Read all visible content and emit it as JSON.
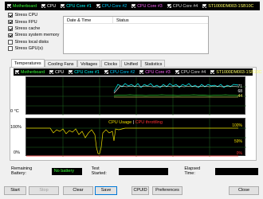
{
  "colors": {
    "motherboard": "#39ff39",
    "cpu": "#ffffff",
    "core1": "#00ffff",
    "core2": "#00ccff",
    "core3": "#ff66ff",
    "core4": "#dddddd",
    "disk": "#ffff66",
    "usage": "#f0e000",
    "throttling": "#ff3030"
  },
  "top_legend": [
    {
      "label": "Motherboard",
      "checked": true,
      "color": "#39ff39"
    },
    {
      "label": "CPU",
      "checked": true,
      "color": "#ffffff"
    },
    {
      "label": "CPU Core #1",
      "checked": true,
      "color": "#00ffff"
    },
    {
      "label": "CPU Core #2",
      "checked": true,
      "color": "#00ccff"
    },
    {
      "label": "CPU Core #3",
      "checked": true,
      "color": "#ff66ff"
    },
    {
      "label": "CPU Core #4",
      "checked": true,
      "color": "#dddddd"
    },
    {
      "label": "ST1000DM003-1SB10C",
      "checked": true,
      "color": "#ffff66"
    }
  ],
  "stress_options": [
    {
      "label": "Stress CPU",
      "checked": true
    },
    {
      "label": "Stress FPU",
      "checked": true
    },
    {
      "label": "Stress cache",
      "checked": true
    },
    {
      "label": "Stress system memory",
      "checked": true
    },
    {
      "label": "Stress local disks",
      "checked": false
    },
    {
      "label": "Stress GPU(s)",
      "checked": false
    }
  ],
  "log_table": {
    "col_date": "Date & Time",
    "col_status": "Status"
  },
  "tabs": [
    "Temperatures",
    "Cooling Fans",
    "Voltages",
    "Clocks",
    "Unified",
    "Statistics"
  ],
  "active_tab": "Temperatures",
  "temp_graph": {
    "y_top": "100 °C",
    "y_bottom": "0 °C",
    "right_values": [
      "71",
      "68",
      "44"
    ]
  },
  "usage_graph": {
    "title_usage": "CPU Usage",
    "title_sep": "|",
    "title_throttling": "CPU throttling",
    "y_top": "100%",
    "y_bottom": "0%",
    "right_top": "100%",
    "right_mid": "59%",
    "right_bottom": "0%"
  },
  "status_row": {
    "remaining_battery_label": "Remaining Battery:",
    "remaining_battery_value": "No battery",
    "test_started_label": "Test Started:",
    "test_started_value": "",
    "elapsed_time_label": "Elapsed Time:",
    "elapsed_time_value": ""
  },
  "buttons": {
    "start": "Start",
    "stop": "Stop",
    "clear": "Clear",
    "save": "Save",
    "cpuid": "CPUID",
    "preferences": "Preferences",
    "close": "Close"
  }
}
